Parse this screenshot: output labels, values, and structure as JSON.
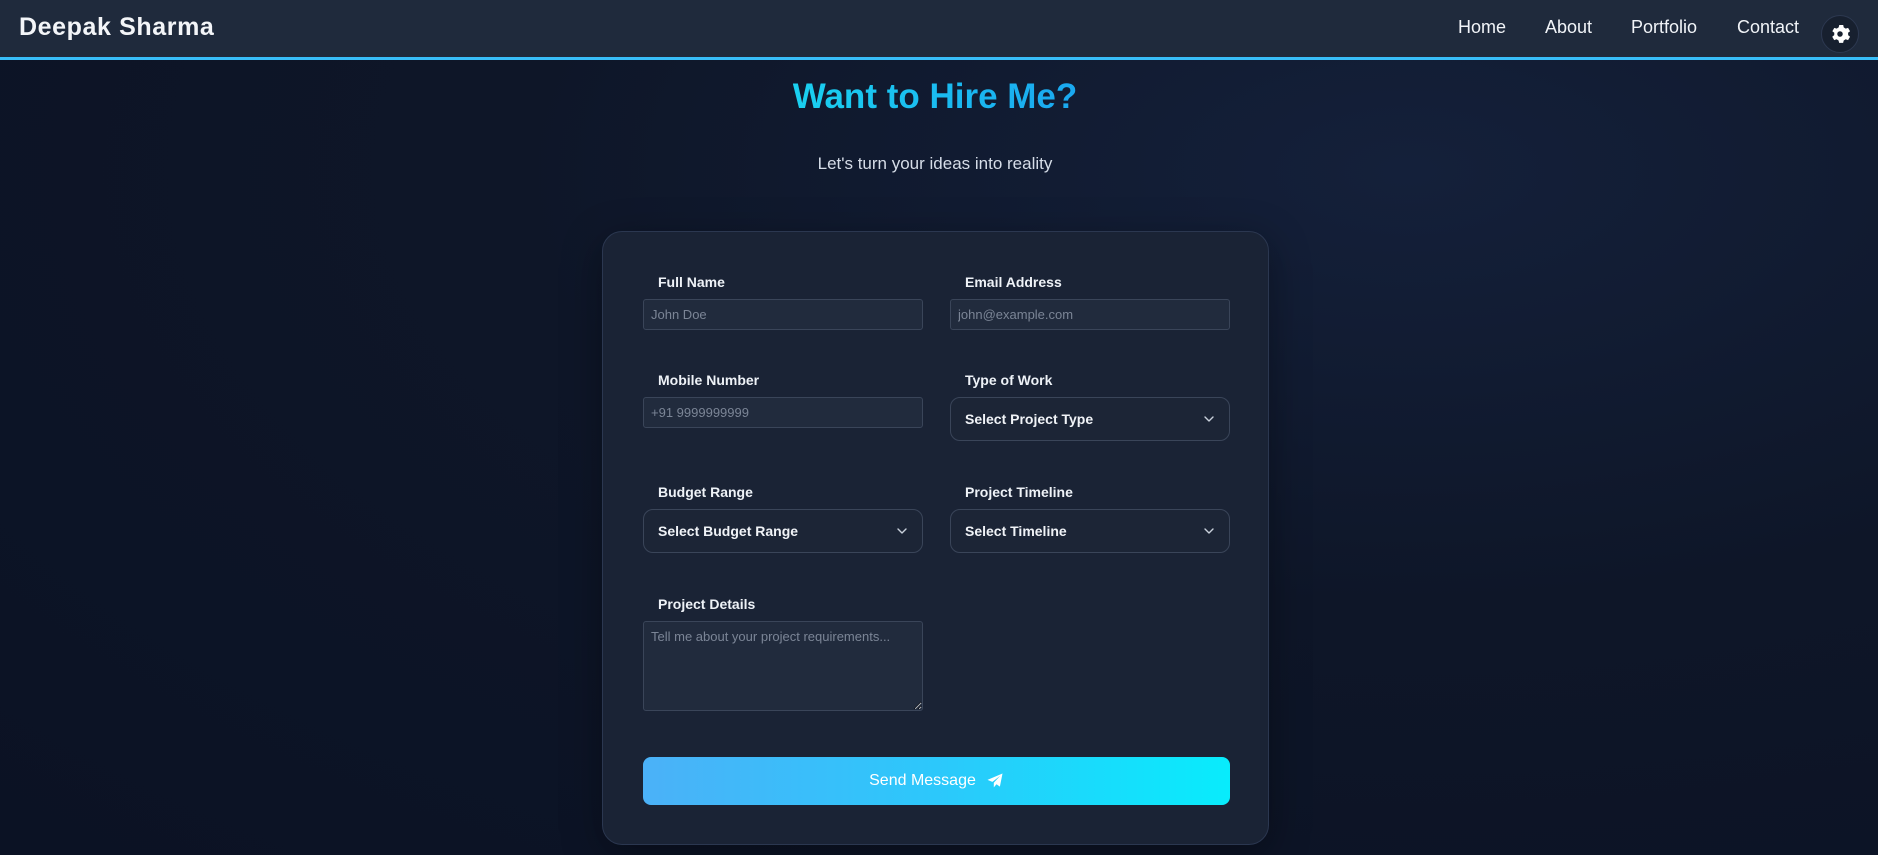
{
  "brand": "Deepak Sharma",
  "nav": {
    "links": [
      "Home",
      "About",
      "Portfolio",
      "Contact"
    ],
    "theme_icon": "gear-icon"
  },
  "hero": {
    "title": "Want to Hire Me?",
    "subtitle": "Let's turn your ideas into reality"
  },
  "form": {
    "full_name": {
      "label": "Full Name",
      "placeholder": "John Doe",
      "value": ""
    },
    "email": {
      "label": "Email Address",
      "placeholder": "john@example.com",
      "value": ""
    },
    "mobile": {
      "label": "Mobile Number",
      "placeholder": "+91 9999999999",
      "value": ""
    },
    "work_type": {
      "label": "Type of Work",
      "selected": "Select Project Type"
    },
    "budget": {
      "label": "Budget Range",
      "selected": "Select Budget Range"
    },
    "timeline": {
      "label": "Project Timeline",
      "selected": "Select Timeline"
    },
    "details": {
      "label": "Project Details",
      "placeholder": "Tell me about your project requirements..."
    },
    "submit_label": "Send Message",
    "submit_icon": "paper-plane-icon"
  },
  "colors": {
    "accent": "#38bdf8",
    "title_gradient_start": "#1ad0f0",
    "button_gradient_end": "#08ecfc",
    "navbar_bg": "#1f2a3c",
    "card_bg": "#1a2335"
  }
}
